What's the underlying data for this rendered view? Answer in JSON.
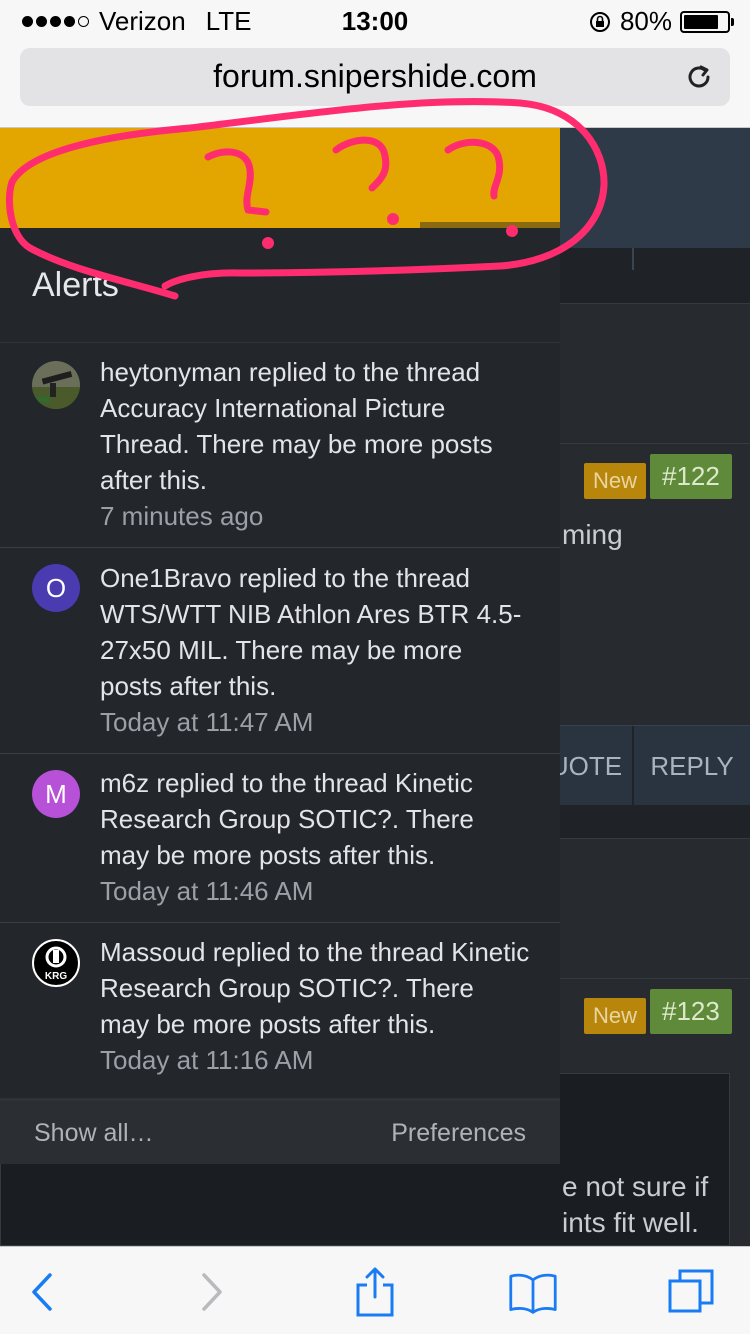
{
  "status_bar": {
    "carrier": "Verizon",
    "network": "LTE",
    "time": "13:00",
    "battery": "80%",
    "battery_level": 0.8
  },
  "browser": {
    "url": "forum.snipershide.com"
  },
  "background_page": {
    "post_1": {
      "new_badge": "New",
      "post_number": "#122",
      "text_fragment": "ming"
    },
    "actions": {
      "quote": "UOTE",
      "reply": "REPLY"
    },
    "post_2": {
      "new_badge": "New",
      "post_number": "#123",
      "text_fragment_1": "e not sure if",
      "text_fragment_2": "ints fit well."
    }
  },
  "alerts": {
    "title": "Alerts",
    "items": [
      {
        "avatar_letter": "",
        "avatar_color": "#5a6a3a",
        "text": "heytonyman replied to the thread Accuracy International Picture Thread. There may be more posts after this.",
        "time": "7 minutes ago"
      },
      {
        "avatar_letter": "O",
        "avatar_color": "#4a3bb0",
        "text": "One1Bravo replied to the thread WTS/WTT NIB Athlon Ares BTR 4.5-27x50 MIL. There may be more posts after this.",
        "time": "Today at 11:47 AM"
      },
      {
        "avatar_letter": "M",
        "avatar_color": "#b651d8",
        "text": "m6z replied to the thread Kinetic Research Group SOTIC?. There may be more posts after this.",
        "time": "Today at 11:46 AM"
      },
      {
        "avatar_letter": "KRG",
        "avatar_color": "#000000",
        "text": "Massoud replied to the thread Kinetic Research Group SOTIC?. There may be more posts after this.",
        "time": "Today at 11:16 AM"
      }
    ],
    "show_all": "Show all…",
    "preferences": "Preferences"
  },
  "colors": {
    "header_accent": "#e3a500",
    "annotation": "#ff2d6f",
    "ios_blue": "#1a7cf5"
  },
  "icons": [
    "reload-icon",
    "back-icon",
    "forward-icon",
    "share-icon",
    "bookmarks-icon",
    "tabs-icon",
    "lock-rotation-icon",
    "battery-icon"
  ]
}
